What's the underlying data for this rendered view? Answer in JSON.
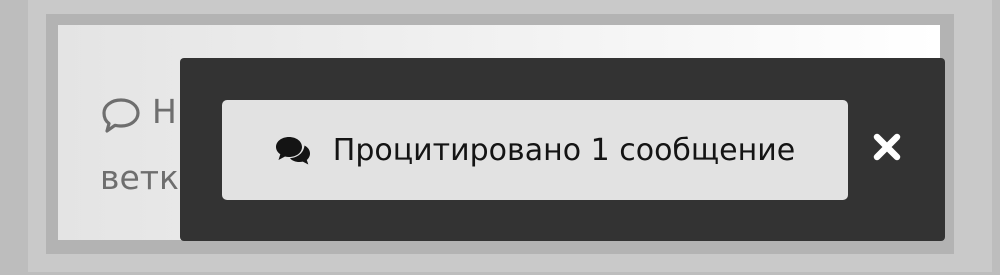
{
  "background": {
    "line1_text": "Н",
    "line2_text": "ветк"
  },
  "tooltip": {
    "quote_button_label": "Процитировано 1 сообщение",
    "quote_icon": "comments-icon",
    "close_icon": "close-icon"
  },
  "colors": {
    "tooltip_bg": "#333333",
    "button_bg": "#e2e2e2",
    "text_dark": "#141414",
    "muted_text": "#6e6e6e"
  }
}
